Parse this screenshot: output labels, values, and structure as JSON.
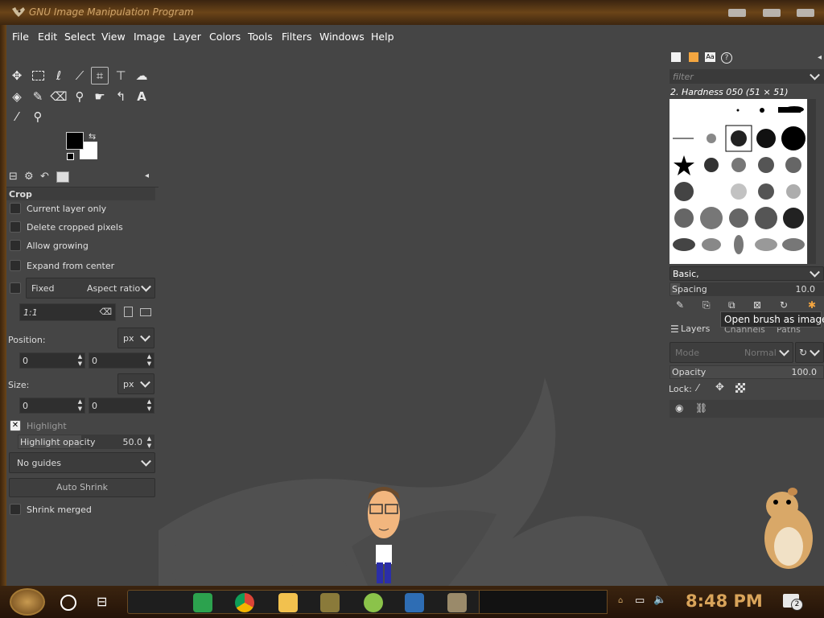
{
  "window": {
    "title": "GNU Image Manipulation Program"
  },
  "menubar": {
    "items": [
      "File",
      "Edit",
      "Select",
      "View",
      "Image",
      "Layer",
      "Colors",
      "Tools",
      "Filters",
      "Windows",
      "Help"
    ]
  },
  "toolbox": {
    "tools": [
      "move-tool",
      "rect-select-tool",
      "free-select-tool",
      "fuzzy-select-tool",
      "crop-tool",
      "transform-tool",
      "warp-tool",
      "bucket-fill-tool",
      "paintbrush-tool",
      "eraser-tool",
      "clone-tool",
      "smudge-tool",
      "paths-tool",
      "text-tool",
      "color-picker-tool",
      "zoom-tool"
    ],
    "active_tool": "crop-tool",
    "fg_color": "#000000",
    "bg_color": "#ffffff"
  },
  "tool_options": {
    "title": "Crop",
    "current_layer_only": "Current layer only",
    "delete_cropped_pixels": "Delete cropped pixels",
    "allow_growing": "Allow growing",
    "expand_from_center": "Expand from center",
    "fixed_label": "Fixed",
    "fixed_mode": "Aspect ratio",
    "ratio_value": "1:1",
    "position_label": "Position:",
    "position_unit": "px",
    "position_x": "0",
    "position_y": "0",
    "size_label": "Size:",
    "size_unit": "px",
    "size_w": "0",
    "size_h": "0",
    "highlight_label": "Highlight",
    "highlight_opacity_label": "Highlight opacity",
    "highlight_opacity_value": "50.0",
    "guides_value": "No guides",
    "auto_shrink_label": "Auto Shrink",
    "shrink_merged_label": "Shrink merged"
  },
  "brushes": {
    "filter_placeholder": "filter",
    "current_brush": "2. Hardness 050 (51 × 51)",
    "tag_value": "Basic,",
    "spacing_label": "Spacing",
    "spacing_value": "10.0",
    "tooltip": "Open brush as image"
  },
  "layers": {
    "tabs": [
      "Layers",
      "Channels",
      "Paths"
    ],
    "mode_label": "Mode",
    "mode_value": "Normal",
    "opacity_label": "Opacity",
    "opacity_value": "100.0",
    "lock_label": "Lock:"
  },
  "taskbar": {
    "clock": "8:48 PM",
    "notification_count": "2",
    "apps": [
      "spreadsheets-icon",
      "chrome-icon",
      "file-explorer-icon",
      "sandbox-icon",
      "lime-icon",
      "virtualbox-icon",
      "gimp-icon"
    ]
  }
}
